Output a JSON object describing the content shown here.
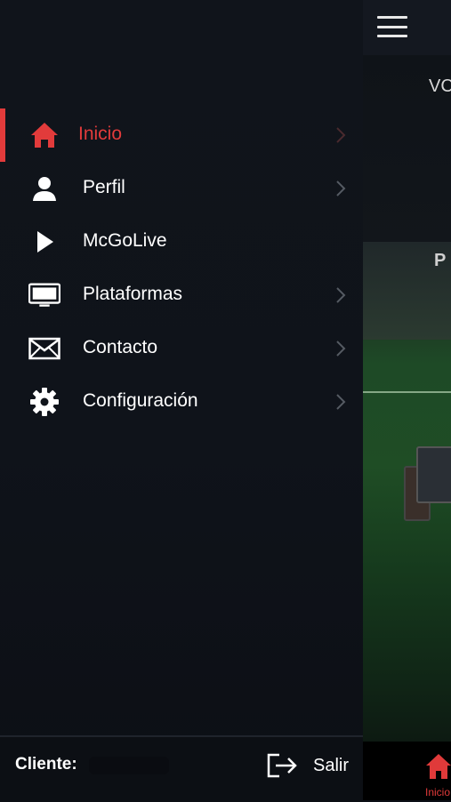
{
  "background": {
    "peek_text_top": "VC",
    "peek_text_mid": "P",
    "bottom_nav": {
      "home_label": "Inicio",
      "home_icon": "home-icon"
    }
  },
  "drawer": {
    "items": [
      {
        "label": "Inicio",
        "icon": "home-icon",
        "active": true
      },
      {
        "label": "Perfil",
        "icon": "user-icon",
        "active": false
      },
      {
        "label": "McGoLive",
        "icon": "play-icon",
        "active": false
      },
      {
        "label": "Plataformas",
        "icon": "tv-icon",
        "active": false
      },
      {
        "label": "Contacto",
        "icon": "mail-icon",
        "active": false
      },
      {
        "label": "Configuración",
        "icon": "gear-icon",
        "active": false
      }
    ],
    "footer": {
      "client_label": "Cliente:",
      "logout_label": "Salir"
    }
  },
  "colors": {
    "accent": "#e23b3b",
    "drawer_bg": "#10141b"
  }
}
